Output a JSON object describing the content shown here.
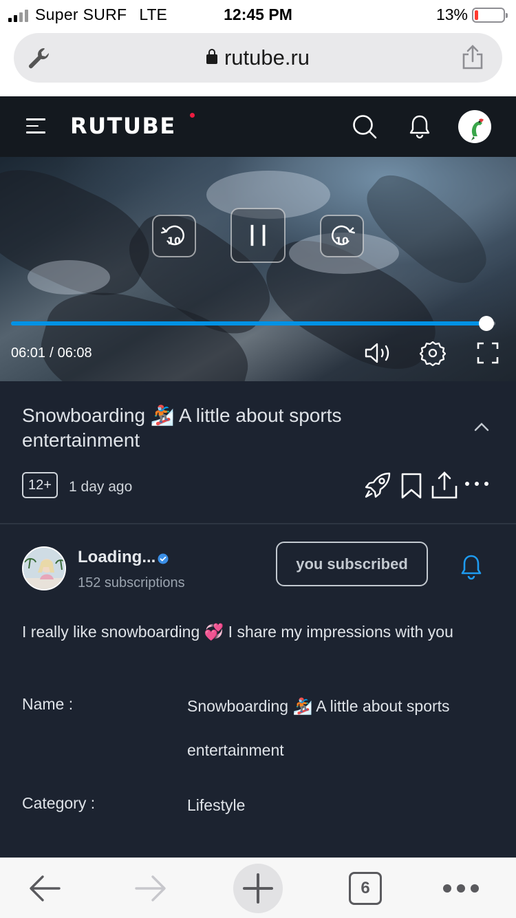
{
  "status_bar": {
    "carrier": "Super SURF",
    "network": "LTE",
    "time": "12:45 PM",
    "battery": "13%",
    "battery_level": 0.13
  },
  "browser": {
    "url": "rutube.ru",
    "open_tabs": "6"
  },
  "header": {
    "logo": "RUTUBE"
  },
  "player": {
    "current_time": "06:01",
    "separator": "/",
    "duration": "06:08",
    "progress": 0.981,
    "rewind_label": "10",
    "forward_label": "10"
  },
  "video": {
    "title": "Snowboarding 🏂 A little about sports entertainment",
    "age_rating": "12+",
    "published": "1 day ago"
  },
  "channel": {
    "name": "Loading...",
    "subscriptions": "152 subscriptions",
    "subscribe_label": "you subscribed",
    "description": "I really like snowboarding 💞 I share my impressions with you"
  },
  "meta": {
    "name_label": "Name :",
    "name_value": "Snowboarding 🏂 A little about sports entertainment",
    "category_label": "Category :",
    "category_value": "Lifestyle"
  },
  "colors": {
    "accent": "#0092e5",
    "header_bg": "#14191f",
    "page_bg": "#1c2330",
    "logo_dot": "#ed1c40",
    "battery_low": "#ff3b30"
  }
}
